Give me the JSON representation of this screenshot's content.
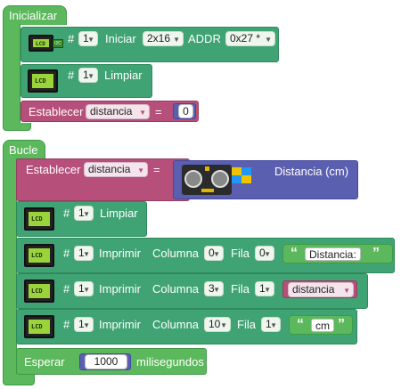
{
  "initialize": {
    "title": "Inicializar",
    "init_block": {
      "hash": "#",
      "index": "1",
      "iniciar": "Iniciar",
      "size": "2x16",
      "addr_label": "ADDR",
      "addr": "0x27 *"
    },
    "clear_block": {
      "hash": "#",
      "index": "1",
      "label": "Limpiar"
    },
    "set_block": {
      "label": "Establecer",
      "variable": "distancia",
      "equals": "=",
      "value": "0"
    }
  },
  "loop": {
    "title": "Bucle",
    "set_block": {
      "label": "Establecer",
      "variable": "distancia",
      "equals": "=",
      "sensor_label": "Distancia (cm)"
    },
    "clear_block": {
      "hash": "#",
      "index": "1",
      "label": "Limpiar"
    },
    "print_blocks": [
      {
        "hash": "#",
        "index": "1",
        "label": "Imprimir",
        "col_label": "Columna",
        "col": "0",
        "row_label": "Fila",
        "row": "0",
        "value": "Distancia:",
        "value_type": "text"
      },
      {
        "hash": "#",
        "index": "1",
        "label": "Imprimir",
        "col_label": "Columna",
        "col": "3",
        "row_label": "Fila",
        "row": "1",
        "value": "distancia",
        "value_type": "variable"
      },
      {
        "hash": "#",
        "index": "1",
        "label": "Imprimir",
        "col_label": "Columna",
        "col": "10",
        "row_label": "Fila",
        "row": "1",
        "value": "cm",
        "value_type": "text"
      }
    ],
    "wait_block": {
      "label": "Esperar",
      "value": "1000",
      "unit": "milisegundos"
    }
  },
  "icons": {
    "lcd": "lcd-display-icon",
    "sensor": "ultrasonic-sensor-icon",
    "open_quote": "“",
    "close_quote": "”"
  },
  "colors": {
    "control_green": "#5cb85c",
    "lcd_teal": "#40a374",
    "variable_pink": "#b64f7a",
    "sensor_purple": "#5b5fb0"
  }
}
